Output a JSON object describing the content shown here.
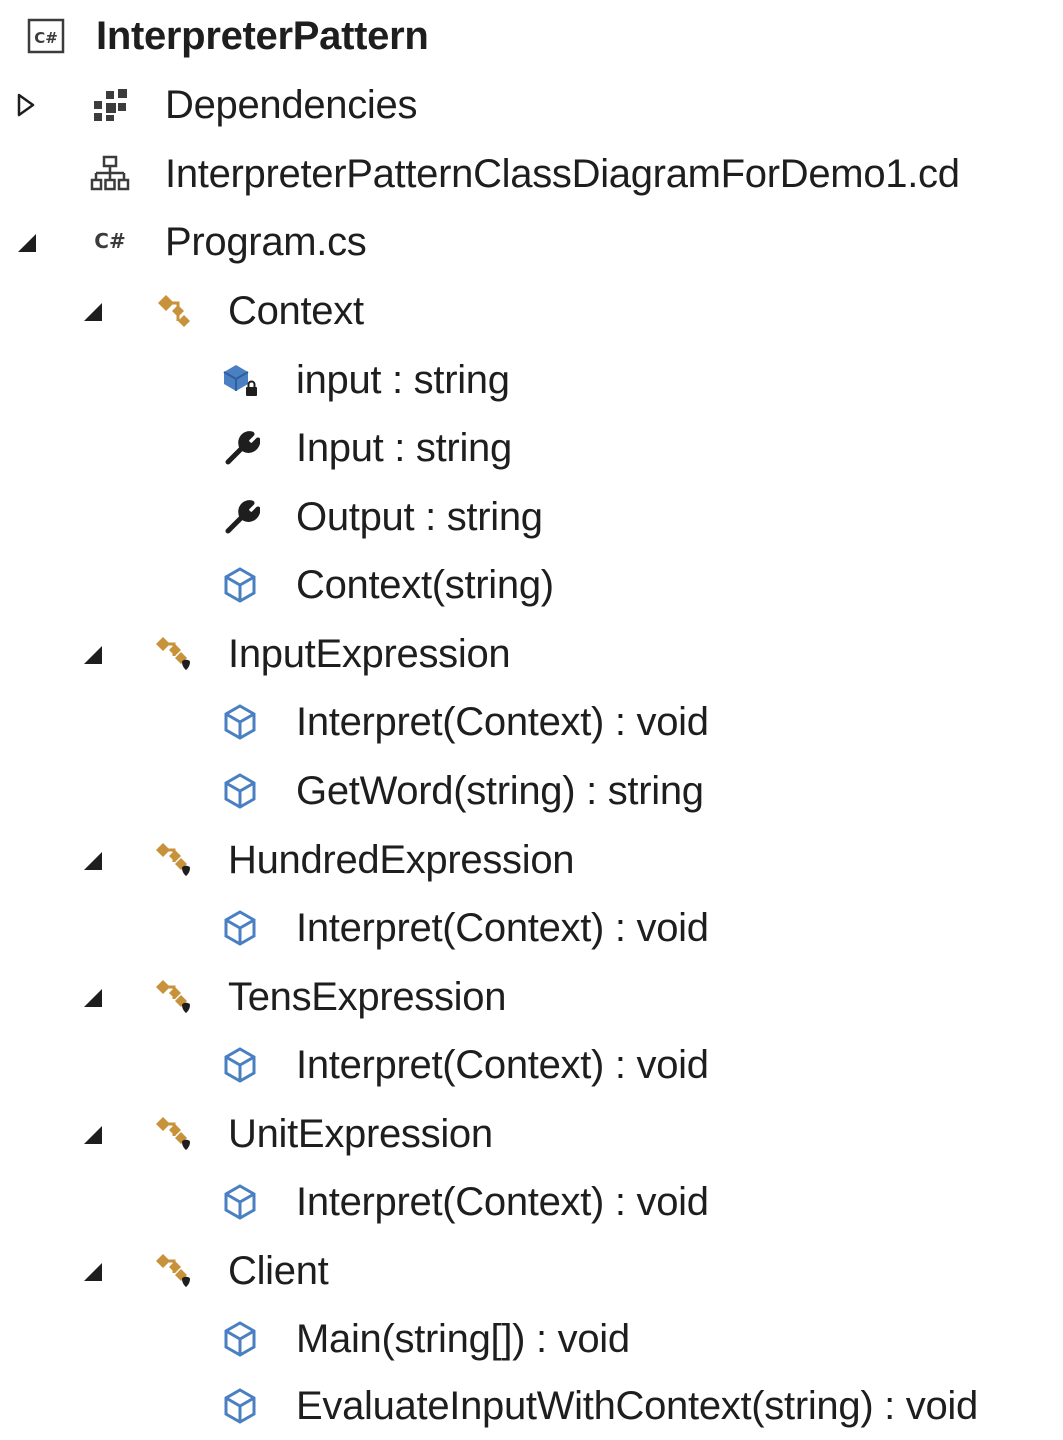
{
  "solution_explorer": {
    "project": {
      "name": "InterpreterPattern",
      "icon": "csharp-project-icon"
    },
    "items": [
      {
        "label": "Dependencies",
        "icon": "dependencies-icon",
        "toggle": "collapsed"
      },
      {
        "label": "InterpreterPatternClassDiagramForDemo1.cd",
        "icon": "class-diagram-icon",
        "toggle": "none"
      },
      {
        "label": "Program.cs",
        "icon": "csharp-file-icon",
        "toggle": "expanded"
      }
    ],
    "classes": [
      {
        "name": "Context",
        "icon": "class-icon",
        "members": [
          {
            "label": "input : string",
            "icon": "private-field-icon"
          },
          {
            "label": "Input : string",
            "icon": "property-icon"
          },
          {
            "label": "Output : string",
            "icon": "property-icon"
          },
          {
            "label": "Context(string)",
            "icon": "method-icon"
          }
        ]
      },
      {
        "name": "InputExpression",
        "icon": "class-icon",
        "members": [
          {
            "label": "Interpret(Context) : void",
            "icon": "method-icon"
          },
          {
            "label": "GetWord(string) : string",
            "icon": "method-icon"
          }
        ]
      },
      {
        "name": "HundredExpression",
        "icon": "class-icon",
        "members": [
          {
            "label": "Interpret(Context) : void",
            "icon": "method-icon"
          }
        ]
      },
      {
        "name": "TensExpression",
        "icon": "class-icon",
        "members": [
          {
            "label": "Interpret(Context) : void",
            "icon": "method-icon"
          }
        ]
      },
      {
        "name": "UnitExpression",
        "icon": "class-icon",
        "members": [
          {
            "label": "Interpret(Context) : void",
            "icon": "method-icon"
          }
        ]
      },
      {
        "name": "Client",
        "icon": "class-icon",
        "members": [
          {
            "label": "Main(string[]) : void",
            "icon": "method-icon"
          },
          {
            "label": "EvaluateInputWithContext(string) : void",
            "icon": "method-icon"
          }
        ]
      }
    ],
    "colors": {
      "class_icon": "#c8923a",
      "method_icon": "#4a7fc1",
      "text": "#1e1e1e"
    }
  }
}
